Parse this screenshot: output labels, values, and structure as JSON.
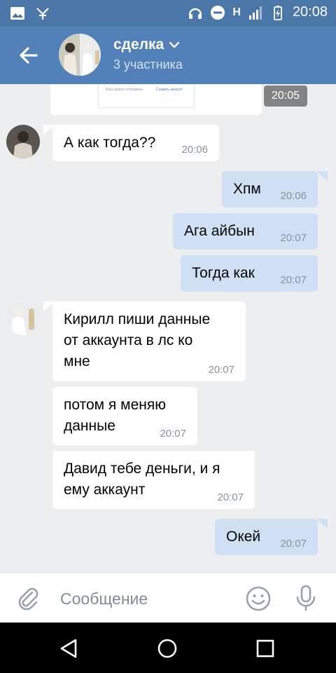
{
  "status_bar": {
    "time": "20:08",
    "network_label": "H"
  },
  "header": {
    "title": "сделка",
    "subtitle": "3 участника"
  },
  "photo_message": {
    "time": "20:05",
    "preview_left_text": "Ваш запрос отправлен",
    "preview_right_text": "Создать аккаунт"
  },
  "messages": [
    {
      "direction": "in",
      "text": "А как тогда??",
      "time": "20:06"
    },
    {
      "direction": "out",
      "text": "Хпм",
      "time": "20:06"
    },
    {
      "direction": "out",
      "text": "Ага айбын",
      "time": "20:07"
    },
    {
      "direction": "out",
      "text": "Тогда как",
      "time": "20:07"
    },
    {
      "direction": "in",
      "lines": [
        "Кирилл пиши данные",
        "от аккаунта в лс ко",
        "мне"
      ],
      "time": "20:07"
    },
    {
      "direction": "in",
      "lines": [
        "потом я меняю",
        "данные"
      ],
      "time": "20:07"
    },
    {
      "direction": "in",
      "lines": [
        "Давид тебе деньги, и я",
        "ему аккаунт"
      ],
      "time": "20:07"
    },
    {
      "direction": "out",
      "text": "Окей",
      "time": "20:07"
    }
  ],
  "input": {
    "placeholder": "Сообщение"
  },
  "colors": {
    "header": "#5181b8",
    "status_bar": "#4a76a8",
    "outgoing_bubble": "#cfe0f4",
    "background": "#edeef0"
  },
  "icons": {
    "back": "arrow-left-icon",
    "attach": "paperclip-icon",
    "emoji": "smile-icon",
    "mic": "microphone-icon",
    "nav_back": "triangle-back-icon",
    "nav_home": "circle-home-icon",
    "nav_recent": "square-recent-icon"
  }
}
